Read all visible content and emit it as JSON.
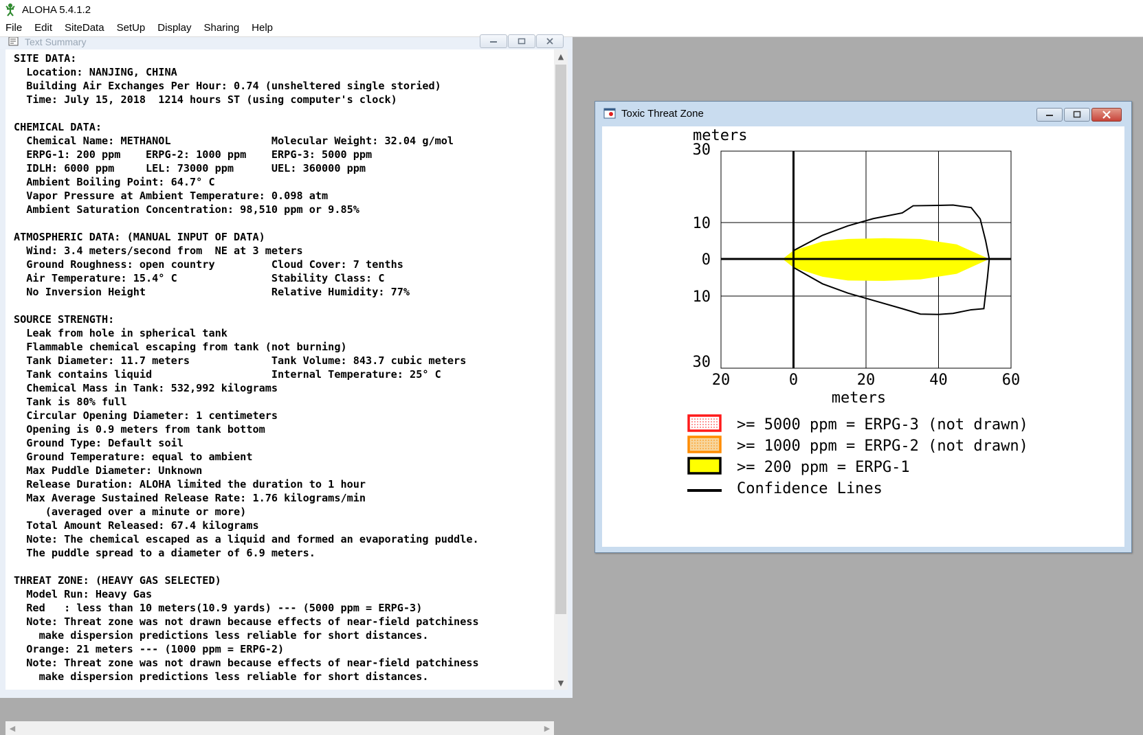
{
  "app": {
    "title": "ALOHA 5.4.1.2",
    "menu": [
      "File",
      "Edit",
      "SiteData",
      "SetUp",
      "Display",
      "Sharing",
      "Help"
    ]
  },
  "text_window": {
    "title": "Text Summary",
    "summary": "SITE DATA:\n  Location: NANJING, CHINA\n  Building Air Exchanges Per Hour: 0.74 (unsheltered single storied)\n  Time: July 15, 2018  1214 hours ST (using computer's clock)\n\nCHEMICAL DATA:\n  Chemical Name: METHANOL                Molecular Weight: 32.04 g/mol\n  ERPG-1: 200 ppm    ERPG-2: 1000 ppm    ERPG-3: 5000 ppm\n  IDLH: 6000 ppm     LEL: 73000 ppm      UEL: 360000 ppm\n  Ambient Boiling Point: 64.7° C\n  Vapor Pressure at Ambient Temperature: 0.098 atm\n  Ambient Saturation Concentration: 98,510 ppm or 9.85%\n\nATMOSPHERIC DATA: (MANUAL INPUT OF DATA)\n  Wind: 3.4 meters/second from  NE at 3 meters\n  Ground Roughness: open country         Cloud Cover: 7 tenths\n  Air Temperature: 15.4° C               Stability Class: C\n  No Inversion Height                    Relative Humidity: 77%\n\nSOURCE STRENGTH:\n  Leak from hole in spherical tank\n  Flammable chemical escaping from tank (not burning)\n  Tank Diameter: 11.7 meters             Tank Volume: 843.7 cubic meters\n  Tank contains liquid                   Internal Temperature: 25° C\n  Chemical Mass in Tank: 532,992 kilograms\n  Tank is 80% full\n  Circular Opening Diameter: 1 centimeters\n  Opening is 0.9 meters from tank bottom\n  Ground Type: Default soil\n  Ground Temperature: equal to ambient\n  Max Puddle Diameter: Unknown\n  Release Duration: ALOHA limited the duration to 1 hour\n  Max Average Sustained Release Rate: 1.76 kilograms/min\n     (averaged over a minute or more)\n  Total Amount Released: 67.4 kilograms\n  Note: The chemical escaped as a liquid and formed an evaporating puddle.\n  The puddle spread to a diameter of 6.9 meters.\n\nTHREAT ZONE: (HEAVY GAS SELECTED)\n  Model Run: Heavy Gas\n  Red   : less than 10 meters(10.9 yards) --- (5000 ppm = ERPG-3)\n  Note: Threat zone was not drawn because effects of near-field patchiness\n    make dispersion predictions less reliable for short distances.\n  Orange: 21 meters --- (1000 ppm = ERPG-2)\n  Note: Threat zone was not drawn because effects of near-field patchiness\n    make dispersion predictions less reliable for short distances."
  },
  "threat_window": {
    "title": "Toxic Threat Zone",
    "legend": [
      {
        "label": ">= 5000 ppm = ERPG-3 (not drawn)",
        "color": "#ff1a1a",
        "fill": "#ffffff",
        "style": "dotted"
      },
      {
        "label": ">= 1000 ppm = ERPG-2 (not drawn)",
        "color": "#ff8c00",
        "fill": "#f7d59c",
        "style": "dotted"
      },
      {
        "label": ">= 200 ppm = ERPG-1",
        "color": "#000000",
        "fill": "#ffff00",
        "style": "solid"
      },
      {
        "label": "Confidence Lines",
        "color": "#000000",
        "style": "line"
      }
    ]
  },
  "chart_data": {
    "type": "area",
    "xlabel": "meters",
    "ylabel": "meters",
    "xlim": [
      -20,
      60
    ],
    "ylim": [
      -30,
      30
    ],
    "x_tick_labels": [
      "20",
      "0",
      "20",
      "40",
      "60"
    ],
    "x_tick_values": [
      -20,
      0,
      20,
      40,
      60
    ],
    "y_tick_labels": [
      "30",
      "10",
      "0",
      "10",
      "30"
    ],
    "y_tick_values": [
      30,
      10,
      0,
      -10,
      -30
    ],
    "grid": true,
    "series": [
      {
        "name": ">= 200 ppm = ERPG-1",
        "kind": "threat_zone",
        "color": "#ffff00",
        "x": [
          -3,
          0,
          8,
          15,
          25,
          35,
          45,
          54,
          45,
          35,
          25,
          15,
          8,
          0,
          -3
        ],
        "y": [
          0,
          2.3,
          4.8,
          5.5,
          5.7,
          5.5,
          4,
          0,
          -4,
          -5.5,
          -5.9,
          -5.8,
          -4.8,
          -2.3,
          0
        ]
      },
      {
        "name": "Confidence Lines",
        "kind": "confidence_upper",
        "color": "#000000",
        "x": [
          0,
          8,
          15,
          22,
          30,
          33,
          40,
          44,
          49,
          51.5,
          53,
          54
        ],
        "y": [
          2.3,
          6.5,
          9.1,
          11.1,
          12.7,
          14.7,
          14.8,
          14.9,
          14.2,
          11,
          5,
          0
        ]
      },
      {
        "name": "Confidence Lines",
        "kind": "confidence_lower",
        "color": "#000000",
        "x": [
          0,
          8,
          15,
          22,
          30,
          35,
          40,
          44,
          49,
          52.5,
          53.5,
          54
        ],
        "y": [
          -2.3,
          -6.7,
          -9.2,
          -11.2,
          -13.5,
          -15,
          -15.1,
          -14.8,
          -13.8,
          -13.5,
          -5,
          0
        ]
      },
      {
        "name": "Source Point",
        "kind": "source",
        "color": "#000000",
        "x": [
          0
        ],
        "y": [
          0
        ]
      }
    ]
  }
}
